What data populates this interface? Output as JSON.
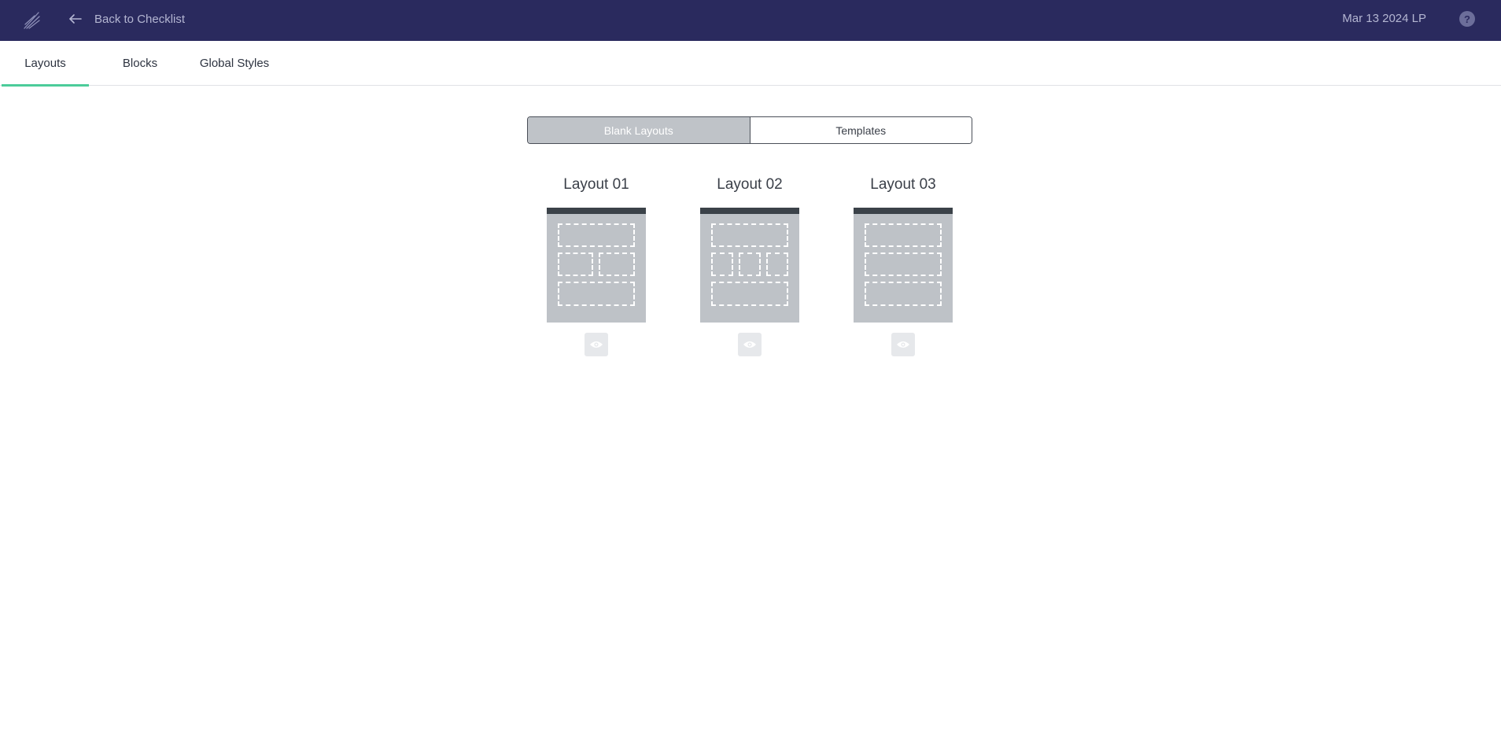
{
  "header": {
    "logo_icon": "feather-logo-icon",
    "back_label": "Back to Checklist",
    "doc_title": "Mar 13 2024 LP",
    "help_label": "?"
  },
  "tabs": [
    {
      "label": "Layouts",
      "active": true
    },
    {
      "label": "Blocks",
      "active": false
    },
    {
      "label": "Global Styles",
      "active": false
    }
  ],
  "segment": {
    "options": [
      "Blank Layouts",
      "Templates"
    ],
    "selected": "Blank Layouts"
  },
  "layouts": [
    {
      "title": "Layout 01",
      "preview_icon": "eye-icon"
    },
    {
      "title": "Layout 02",
      "preview_icon": "eye-icon"
    },
    {
      "title": "Layout 03",
      "preview_icon": "eye-icon"
    }
  ],
  "colors": {
    "header_bg": "#2a2a5e",
    "accent": "#4ccc9a",
    "thumb_bg": "#bec2c7",
    "thumb_top": "#3b4249"
  }
}
